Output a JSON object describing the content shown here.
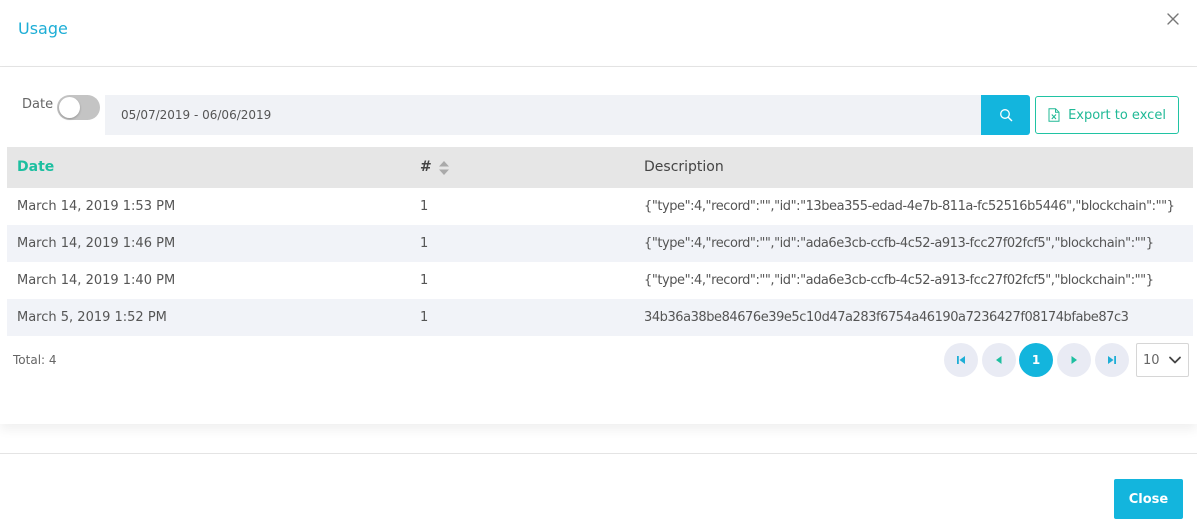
{
  "modal": {
    "title": "Usage",
    "close_label": "Close"
  },
  "filter": {
    "date_label": "Date",
    "date_toggle_on": false,
    "date_range_value": "05/07/2019 - 06/06/2019",
    "export_label": "Export to excel"
  },
  "table": {
    "columns": [
      "Date",
      "#",
      "Description"
    ],
    "rows": [
      {
        "date": "March 14, 2019 1:53 PM",
        "count": "1",
        "description": "{\"type\":4,\"record\":\"\",\"id\":\"13bea355-edad-4e7b-811a-fc52516b5446\",\"blockchain\":\"\"}"
      },
      {
        "date": "March 14, 2019 1:46 PM",
        "count": "1",
        "description": "{\"type\":4,\"record\":\"\",\"id\":\"ada6e3cb-ccfb-4c52-a913-fcc27f02fcf5\",\"blockchain\":\"\"}"
      },
      {
        "date": "March 14, 2019 1:40 PM",
        "count": "1",
        "description": "{\"type\":4,\"record\":\"\",\"id\":\"ada6e3cb-ccfb-4c52-a913-fcc27f02fcf5\",\"blockchain\":\"\"}"
      },
      {
        "date": "March 5, 2019 1:52 PM",
        "count": "1",
        "description": "34b36a38be84676e39e5c10d47a283f6754a46190a7236427f08174bfabe87c3"
      }
    ]
  },
  "pagination": {
    "total_text": "Total: 4",
    "current_page": "1",
    "page_size": "10"
  },
  "colors": {
    "accent_blue": "#13b5dd",
    "accent_green": "#1dbfa0"
  }
}
